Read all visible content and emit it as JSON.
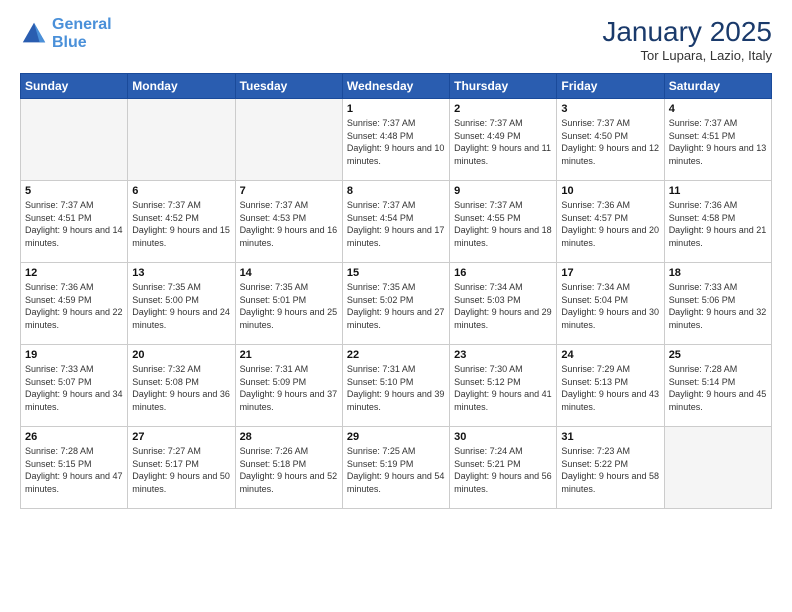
{
  "header": {
    "logo_line1": "General",
    "logo_line2": "Blue",
    "month": "January 2025",
    "location": "Tor Lupara, Lazio, Italy"
  },
  "weekdays": [
    "Sunday",
    "Monday",
    "Tuesday",
    "Wednesday",
    "Thursday",
    "Friday",
    "Saturday"
  ],
  "weeks": [
    [
      {
        "day": "",
        "empty": true
      },
      {
        "day": "",
        "empty": true
      },
      {
        "day": "",
        "empty": true
      },
      {
        "day": "1",
        "sunrise": "7:37 AM",
        "sunset": "4:48 PM",
        "daylight": "9 hours and 10 minutes."
      },
      {
        "day": "2",
        "sunrise": "7:37 AM",
        "sunset": "4:49 PM",
        "daylight": "9 hours and 11 minutes."
      },
      {
        "day": "3",
        "sunrise": "7:37 AM",
        "sunset": "4:50 PM",
        "daylight": "9 hours and 12 minutes."
      },
      {
        "day": "4",
        "sunrise": "7:37 AM",
        "sunset": "4:51 PM",
        "daylight": "9 hours and 13 minutes."
      }
    ],
    [
      {
        "day": "5",
        "sunrise": "7:37 AM",
        "sunset": "4:51 PM",
        "daylight": "9 hours and 14 minutes."
      },
      {
        "day": "6",
        "sunrise": "7:37 AM",
        "sunset": "4:52 PM",
        "daylight": "9 hours and 15 minutes."
      },
      {
        "day": "7",
        "sunrise": "7:37 AM",
        "sunset": "4:53 PM",
        "daylight": "9 hours and 16 minutes."
      },
      {
        "day": "8",
        "sunrise": "7:37 AM",
        "sunset": "4:54 PM",
        "daylight": "9 hours and 17 minutes."
      },
      {
        "day": "9",
        "sunrise": "7:37 AM",
        "sunset": "4:55 PM",
        "daylight": "9 hours and 18 minutes."
      },
      {
        "day": "10",
        "sunrise": "7:36 AM",
        "sunset": "4:57 PM",
        "daylight": "9 hours and 20 minutes."
      },
      {
        "day": "11",
        "sunrise": "7:36 AM",
        "sunset": "4:58 PM",
        "daylight": "9 hours and 21 minutes."
      }
    ],
    [
      {
        "day": "12",
        "sunrise": "7:36 AM",
        "sunset": "4:59 PM",
        "daylight": "9 hours and 22 minutes."
      },
      {
        "day": "13",
        "sunrise": "7:35 AM",
        "sunset": "5:00 PM",
        "daylight": "9 hours and 24 minutes."
      },
      {
        "day": "14",
        "sunrise": "7:35 AM",
        "sunset": "5:01 PM",
        "daylight": "9 hours and 25 minutes."
      },
      {
        "day": "15",
        "sunrise": "7:35 AM",
        "sunset": "5:02 PM",
        "daylight": "9 hours and 27 minutes."
      },
      {
        "day": "16",
        "sunrise": "7:34 AM",
        "sunset": "5:03 PM",
        "daylight": "9 hours and 29 minutes."
      },
      {
        "day": "17",
        "sunrise": "7:34 AM",
        "sunset": "5:04 PM",
        "daylight": "9 hours and 30 minutes."
      },
      {
        "day": "18",
        "sunrise": "7:33 AM",
        "sunset": "5:06 PM",
        "daylight": "9 hours and 32 minutes."
      }
    ],
    [
      {
        "day": "19",
        "sunrise": "7:33 AM",
        "sunset": "5:07 PM",
        "daylight": "9 hours and 34 minutes."
      },
      {
        "day": "20",
        "sunrise": "7:32 AM",
        "sunset": "5:08 PM",
        "daylight": "9 hours and 36 minutes."
      },
      {
        "day": "21",
        "sunrise": "7:31 AM",
        "sunset": "5:09 PM",
        "daylight": "9 hours and 37 minutes."
      },
      {
        "day": "22",
        "sunrise": "7:31 AM",
        "sunset": "5:10 PM",
        "daylight": "9 hours and 39 minutes."
      },
      {
        "day": "23",
        "sunrise": "7:30 AM",
        "sunset": "5:12 PM",
        "daylight": "9 hours and 41 minutes."
      },
      {
        "day": "24",
        "sunrise": "7:29 AM",
        "sunset": "5:13 PM",
        "daylight": "9 hours and 43 minutes."
      },
      {
        "day": "25",
        "sunrise": "7:28 AM",
        "sunset": "5:14 PM",
        "daylight": "9 hours and 45 minutes."
      }
    ],
    [
      {
        "day": "26",
        "sunrise": "7:28 AM",
        "sunset": "5:15 PM",
        "daylight": "9 hours and 47 minutes."
      },
      {
        "day": "27",
        "sunrise": "7:27 AM",
        "sunset": "5:17 PM",
        "daylight": "9 hours and 50 minutes."
      },
      {
        "day": "28",
        "sunrise": "7:26 AM",
        "sunset": "5:18 PM",
        "daylight": "9 hours and 52 minutes."
      },
      {
        "day": "29",
        "sunrise": "7:25 AM",
        "sunset": "5:19 PM",
        "daylight": "9 hours and 54 minutes."
      },
      {
        "day": "30",
        "sunrise": "7:24 AM",
        "sunset": "5:21 PM",
        "daylight": "9 hours and 56 minutes."
      },
      {
        "day": "31",
        "sunrise": "7:23 AM",
        "sunset": "5:22 PM",
        "daylight": "9 hours and 58 minutes."
      },
      {
        "day": "",
        "empty": true
      }
    ]
  ]
}
